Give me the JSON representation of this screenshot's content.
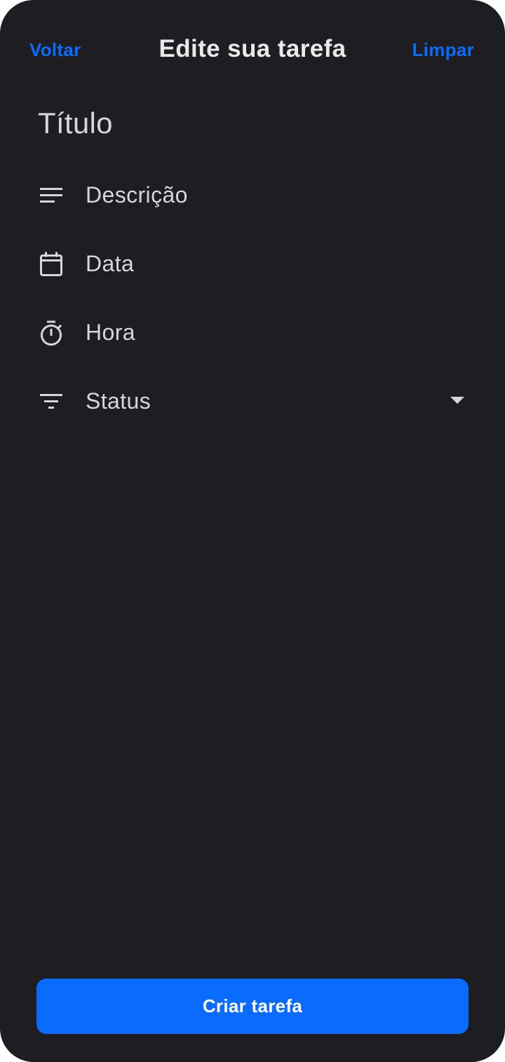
{
  "header": {
    "back_label": "Voltar",
    "title": "Edite sua tarefa",
    "clear_label": "Limpar"
  },
  "form": {
    "title_placeholder": "Título",
    "fields": [
      {
        "icon": "description-lines-icon",
        "label": "Descrição"
      },
      {
        "icon": "calendar-icon",
        "label": "Data"
      },
      {
        "icon": "stopwatch-icon",
        "label": "Hora"
      },
      {
        "icon": "filter-icon",
        "label": "Status",
        "dropdown": true
      }
    ]
  },
  "footer": {
    "submit_label": "Criar tarefa"
  },
  "colors": {
    "background": "#1e1e22",
    "accent": "#0a6cff",
    "text": "#d6d6db",
    "title_text": "#e9e9ec"
  }
}
